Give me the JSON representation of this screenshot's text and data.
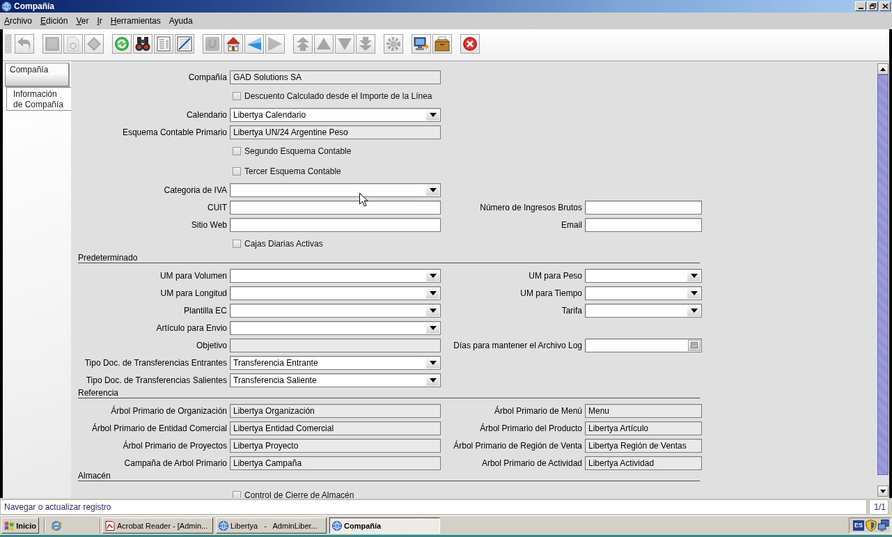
{
  "window": {
    "title": "Compañía"
  },
  "menu": [
    {
      "label": "Archivo",
      "mnemonic": true
    },
    {
      "label": "Edición",
      "mnemonic": true
    },
    {
      "label": "Ver",
      "mnemonic": true
    },
    {
      "label": "Ir",
      "mnemonic": true
    },
    {
      "label": "Herramientas",
      "mnemonic": true
    },
    {
      "label": "Ayuda",
      "mnemonic": false
    }
  ],
  "toolbar": {
    "groups": [
      {
        "buttons": [
          {
            "kind": "undo",
            "disabled": true
          }
        ]
      },
      {
        "buttons": [
          {
            "kind": "new",
            "disabled": true
          },
          {
            "kind": "copy",
            "disabled": true
          },
          {
            "kind": "delete",
            "disabled": true
          }
        ]
      },
      {
        "buttons": [
          {
            "kind": "refresh",
            "disabled": false
          },
          {
            "kind": "find",
            "disabled": false
          },
          {
            "kind": "report",
            "disabled": false
          },
          {
            "kind": "chart",
            "disabled": false
          }
        ]
      },
      {
        "buttons": [
          {
            "kind": "history",
            "disabled": true
          },
          {
            "kind": "home",
            "disabled": false
          },
          {
            "kind": "back",
            "disabled": false
          },
          {
            "kind": "forward",
            "disabled": true
          }
        ]
      },
      {
        "buttons": [
          {
            "kind": "first",
            "disabled": true
          },
          {
            "kind": "previous",
            "disabled": true
          },
          {
            "kind": "next",
            "disabled": true
          },
          {
            "kind": "last",
            "disabled": true
          }
        ]
      },
      {
        "buttons": [
          {
            "kind": "gear",
            "disabled": true
          }
        ]
      },
      {
        "buttons": [
          {
            "kind": "monitor",
            "disabled": false
          },
          {
            "kind": "box",
            "disabled": false
          }
        ]
      },
      {
        "buttons": [
          {
            "kind": "close",
            "disabled": false
          }
        ]
      }
    ]
  },
  "tabs": [
    {
      "label": "Compañía",
      "selected": false
    },
    {
      "label": "Información de Compañía",
      "selected": true
    }
  ],
  "form": {
    "sections": [
      {
        "rows": [
          [
            {
              "kind": "readonly",
              "label": "Compañía",
              "value": "GAD Solutions SA"
            }
          ],
          [
            {
              "kind": "checkbox",
              "label": "Descuento Calculado desde el Importe de la Línea",
              "checked": false
            }
          ],
          [
            {
              "kind": "combo",
              "label": "Calendario",
              "value": "Libertya Calendario"
            }
          ],
          [
            {
              "kind": "readonly",
              "label": "Esquema Contable Primario",
              "value": "Libertya UN/24 Argentine Peso"
            }
          ],
          [
            {
              "kind": "checkbox",
              "label": "Segundo Esquema Contable",
              "checked": false
            }
          ],
          [
            {
              "kind": "checkbox",
              "label": "Tercer Esquema Contable",
              "checked": false
            }
          ],
          [
            {
              "kind": "combo",
              "label": "Categoria de IVA"
            }
          ],
          [
            {
              "kind": "text",
              "label": "CUIT"
            },
            {
              "kind": "text",
              "label": "Número de Ingresos Brutos"
            }
          ],
          [
            {
              "kind": "text",
              "label": "Sitio Web"
            },
            {
              "kind": "text",
              "label": "Email"
            }
          ],
          [
            {
              "kind": "checkbox",
              "label": "Cajas Diarias Activas",
              "checked": false
            }
          ]
        ]
      },
      {
        "title": "Predeterminado",
        "rows": [
          [
            {
              "kind": "combo",
              "label": "UM para Volumen"
            },
            {
              "kind": "combo",
              "label": "UM para Peso"
            }
          ],
          [
            {
              "kind": "combo",
              "label": "UM para Longitud"
            },
            {
              "kind": "combo",
              "label": "UM para Tiempo"
            }
          ],
          [
            {
              "kind": "combo",
              "label": "Plantilla EC"
            },
            {
              "kind": "combo",
              "label": "Tarifa"
            }
          ],
          [
            {
              "kind": "combo",
              "label": "Artículo para Envio"
            }
          ],
          [
            {
              "kind": "readonly",
              "label": "Objetivo"
            },
            {
              "kind": "number",
              "label": "Días para mantener el Archivo Log"
            }
          ],
          [
            {
              "kind": "combo",
              "label": "Tipo Doc. de Transferencias Entrantes",
              "value": "Transferencia Entrante"
            }
          ],
          [
            {
              "kind": "combo",
              "label": "Tipo Doc. de Transferencias Salientes",
              "value": "Transferencia Saliente"
            }
          ]
        ]
      },
      {
        "title": "Referencia",
        "rows": [
          [
            {
              "kind": "readonly",
              "label": "Árbol Primario de Organización",
              "value": "Libertya Organización"
            },
            {
              "kind": "readonly",
              "label": "Árbol Primario de Menú",
              "value": "Menu"
            }
          ],
          [
            {
              "kind": "readonly",
              "label": "Árbol Primario de Entidad Comercial",
              "value": "Libertya Entidad Comercial"
            },
            {
              "kind": "readonly",
              "label": "Árbol Primario del Producto",
              "value": "Libertya Artículo"
            }
          ],
          [
            {
              "kind": "readonly",
              "label": "Árbol Primario de Proyectos",
              "value": "Libertya Proyecto"
            },
            {
              "kind": "readonly",
              "label": "Árbol Primario de Región de Venta",
              "value": "Libertya Región de Ventas"
            }
          ],
          [
            {
              "kind": "readonly",
              "label": "Campaña de Arbol Primario",
              "value": "Libertya Campaña"
            },
            {
              "kind": "readonly",
              "label": "Arbol Primario de Actividad",
              "value": "Libertya Actividad"
            }
          ]
        ]
      },
      {
        "title": "Almacén",
        "rows": [
          [
            {
              "kind": "checkbox",
              "label": "Control de Cierre de Almacén",
              "checked": false
            }
          ]
        ]
      }
    ]
  },
  "status_bar": {
    "message": "Navegar o actualizar registro",
    "record": "1/1"
  },
  "taskbar": {
    "start": "Inicio",
    "tasks": [
      {
        "kind": "pdf",
        "label": "Acrobat Reader - [Admin...",
        "selected": false
      },
      {
        "kind": "app",
        "label": "Libertya   -   AdminLiber...",
        "selected": false
      },
      {
        "kind": "app",
        "label": "Compañía",
        "selected": true
      }
    ],
    "language": "ES"
  }
}
